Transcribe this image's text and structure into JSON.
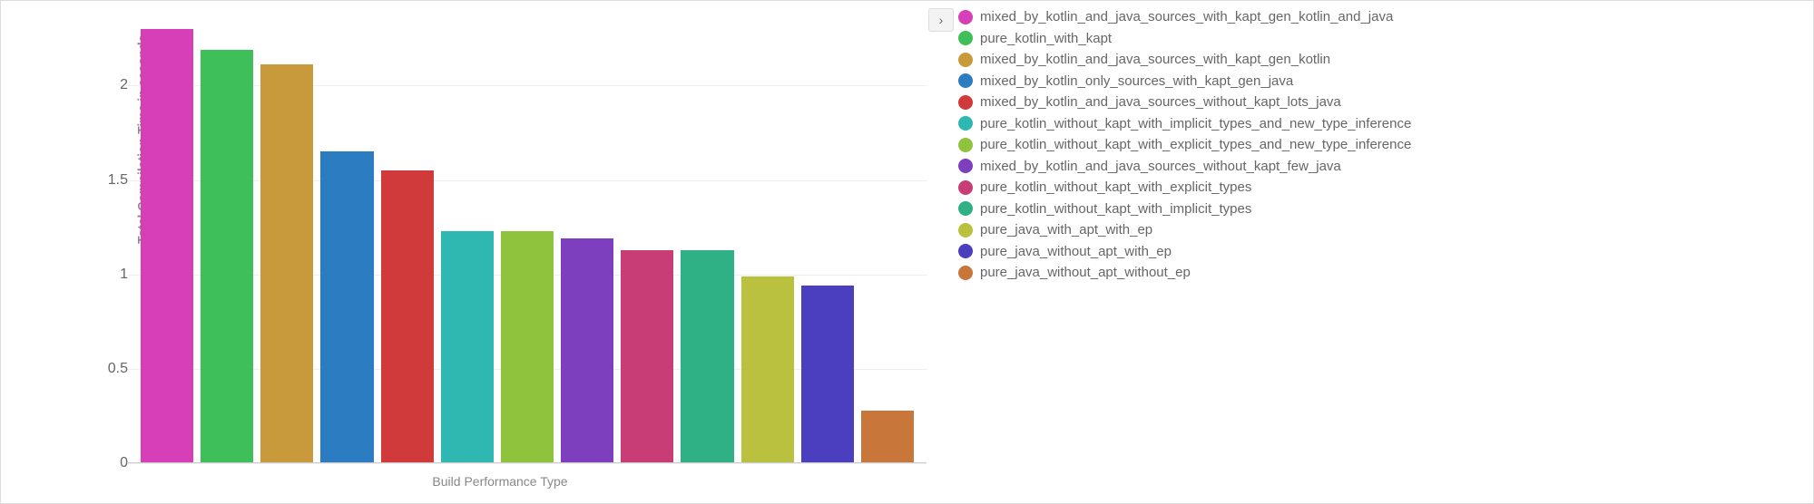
{
  "chart_data": {
    "type": "bar",
    "xlabel": "Build Performance Type",
    "ylabel": "Total Compilation Time in seconds",
    "ylim": [
      0,
      2.4
    ],
    "yticks": [
      0,
      0.5,
      1,
      1.5,
      2
    ],
    "series": [
      {
        "name": "mixed_by_kotlin_and_java_sources_with_kapt_gen_kotlin_and_java",
        "value": 2.3,
        "color": "#d63fb8"
      },
      {
        "name": "pure_kotlin_with_kapt",
        "value": 2.19,
        "color": "#3fbf5a"
      },
      {
        "name": "mixed_by_kotlin_and_java_sources_with_kapt_gen_kotlin",
        "value": 2.11,
        "color": "#c99a3c"
      },
      {
        "name": "mixed_by_kotlin_only_sources_with_kapt_gen_java",
        "value": 1.65,
        "color": "#2b7cc1"
      },
      {
        "name": "mixed_by_kotlin_and_java_sources_without_kapt_lots_java",
        "value": 1.55,
        "color": "#d13a3a"
      },
      {
        "name": "pure_kotlin_without_kapt_with_implicit_types_and_new_type_inference",
        "value": 1.23,
        "color": "#2fb8b1"
      },
      {
        "name": "pure_kotlin_without_kapt_with_explicit_types_and_new_type_inference",
        "value": 1.23,
        "color": "#8fc33e"
      },
      {
        "name": "mixed_by_kotlin_and_java_sources_without_kapt_few_java",
        "value": 1.19,
        "color": "#7e3fbf"
      },
      {
        "name": "pure_kotlin_without_kapt_with_explicit_types",
        "value": 1.13,
        "color": "#c93d76"
      },
      {
        "name": "pure_kotlin_without_kapt_with_implicit_types",
        "value": 1.13,
        "color": "#2fb085"
      },
      {
        "name": "pure_java_with_apt_with_ep",
        "value": 0.99,
        "color": "#b9c13e"
      },
      {
        "name": "pure_java_without_apt_with_ep",
        "value": 0.94,
        "color": "#4c3fbf"
      },
      {
        "name": "pure_java_without_apt_without_ep",
        "value": 0.28,
        "color": "#c9763a"
      }
    ]
  },
  "collapse_glyph": "›"
}
